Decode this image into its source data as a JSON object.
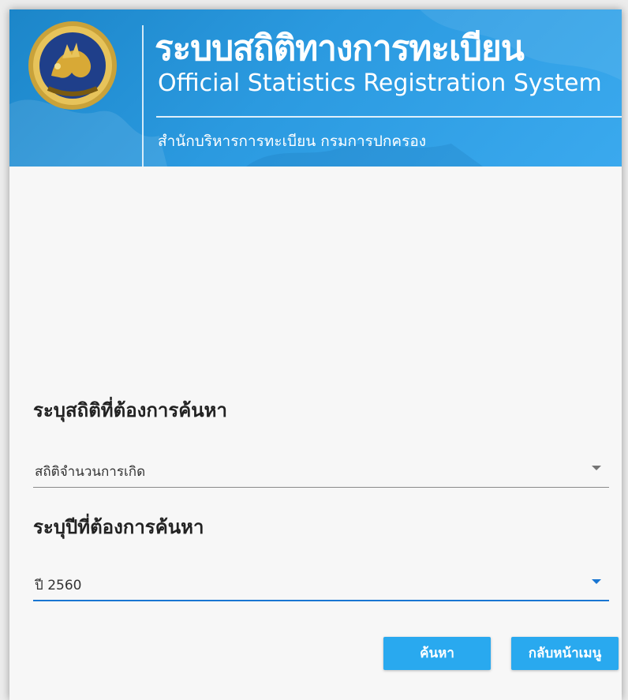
{
  "header": {
    "title_th": "ระบบสถิติทางการทะเบียน",
    "title_en": "Official Statistics Registration System",
    "subtitle_th": "สำนักบริหารการทะเบียน กรมการปกครอง",
    "logo_icon": "department-seal-logo-icon",
    "colors": {
      "header_blue": "#2b9ae0",
      "button_blue": "#29a9ef",
      "focus_blue": "#1976d2"
    }
  },
  "form": {
    "stat_label": "ระบุสถิติที่ต้องการค้นหา",
    "stat_selected": "สถิติจำนวนการเกิด",
    "year_label": "ระบุปีที่ต้องการค้นหา",
    "year_selected": "ปี 2560",
    "dropdown_icon": "caret-down-icon"
  },
  "actions": {
    "search_label": "ค้นหา",
    "back_label": "กลับหน้าเมนู"
  }
}
